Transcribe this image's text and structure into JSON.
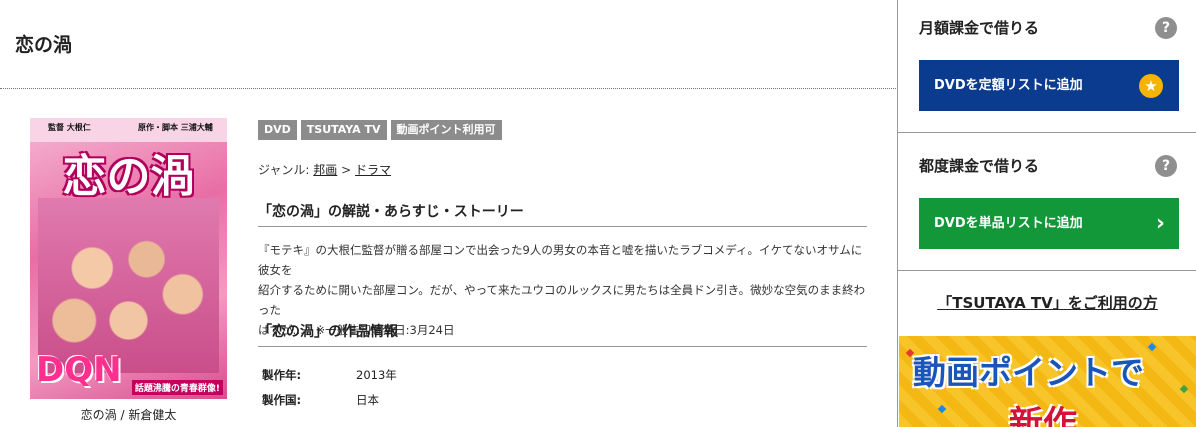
{
  "page": {
    "title": "恋の渦"
  },
  "jacket": {
    "credit_left": "監督 大根仁",
    "credit_right": "原作・脚本 三浦大輔",
    "title_art": "恋の渦",
    "logo_text": "DQN",
    "tagline": "話題沸騰の青春群像!",
    "caption": "恋の渦 / 新倉健太"
  },
  "badges": [
    "DVD",
    "TSUTAYA TV",
    "動画ポイント利用可"
  ],
  "genre": {
    "label": "ジャンル:",
    "parent": "邦画",
    "separator": ">",
    "child": "ドラマ"
  },
  "synopsis": {
    "heading": "「恋の渦」の解説・あらすじ・ストーリー",
    "lines": [
      "『モテキ』の大根仁監督が贈る部屋コンで出会った9人の男女の本音と嘘を描いたラブコメディ。イケてないオサムに彼女を",
      "紹介するために開いた部屋コン。だが、やって来たユウコのルックスに男たちは全員ドン引き。微妙な空気のまま終わった",
      "はずが…。※一般告知解禁日:3月24日"
    ]
  },
  "info": {
    "heading": "「恋の渦」の作品情報",
    "rows": [
      {
        "key": "製作年:",
        "value": "2013年"
      },
      {
        "key": "製作国:",
        "value": "日本"
      }
    ]
  },
  "sidebar": {
    "monthly": {
      "heading": "月額課金で借りる",
      "button": "DVDを定額リストに追加"
    },
    "per_rental": {
      "heading": "都度課金で借りる",
      "button": "DVDを単品リストに追加"
    },
    "tv_link": "「TSUTAYA TV」をご利用の方",
    "banner": {
      "line1": "動画ポイントで",
      "line2": "新作"
    },
    "help_glyph": "?"
  },
  "colors": {
    "monthly_button": "#0a3b8f",
    "per_rental_button": "#129739",
    "badge": "#8c8c8c",
    "star": "#f4b400"
  }
}
